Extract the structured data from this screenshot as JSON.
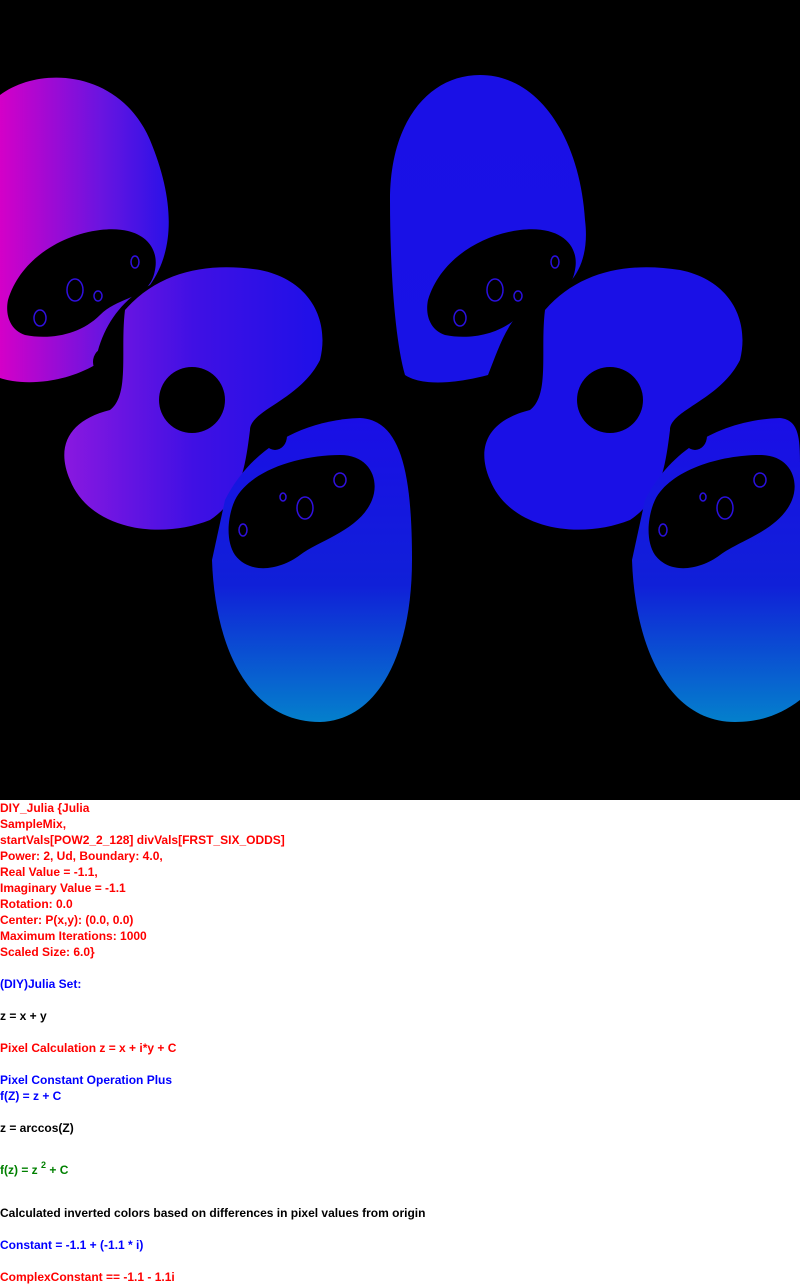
{
  "parameters": {
    "line1": "DIY_Julia {Julia",
    "line2": "SampleMix,",
    "line3": "startVals[POW2_2_128] divVals[FRST_SIX_ODDS]",
    "line4": "Power: 2, Ud, Boundary: 4.0,",
    "line5": "Real Value = -1.1,",
    "line6": "Imaginary Value = -1.1",
    "line7": "Rotation: 0.0",
    "line8": "Center: P(x,y): (0.0, 0.0)",
    "line9": "Maximum Iterations: 1000",
    "line10": "Scaled Size: 6.0}"
  },
  "description": {
    "set_title": "(DIY)Julia Set:",
    "z_def": "z = x + y",
    "pixel_calc": "Pixel Calculation z = x + i*y + C",
    "const_op": "Pixel Constant Operation Plus",
    "fz_plus": "f(Z) = z + C",
    "arccos": "z = arccos(Z)",
    "fz_prefix": "f(z) = z ",
    "fz_power": "2",
    "fz_suffix": " + C",
    "colors_note": "Calculated inverted colors based on differences in pixel values from origin",
    "constant": "Constant = -1.1 + (-1.1 * i)",
    "complex_constant": "ComplexConstant == -1.1 - 1.1i"
  },
  "colors": {
    "background": "#000000",
    "magenta": "#dd00cc",
    "blue": "#1a0ee0",
    "cyan": "#0080d0"
  }
}
